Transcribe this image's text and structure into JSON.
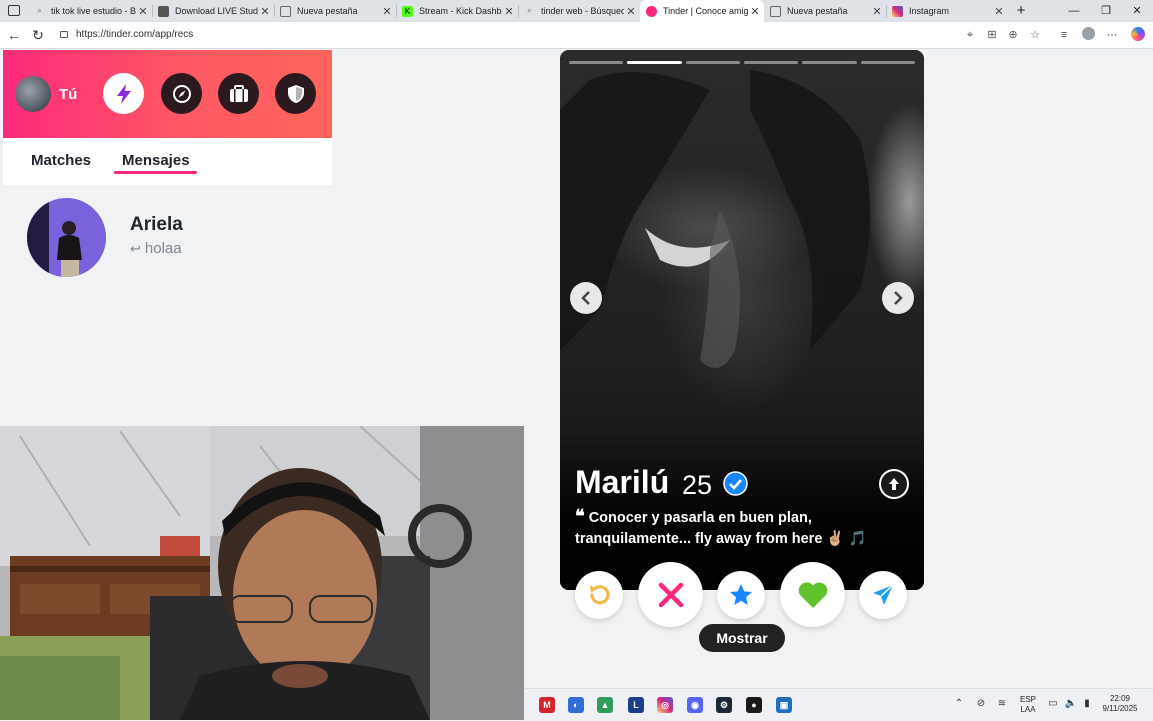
{
  "browser": {
    "tabs": [
      {
        "title": "tik tok live estudio - Bús",
        "active": false
      },
      {
        "title": "Download LIVE Studio",
        "active": false
      },
      {
        "title": "Nueva pestaña",
        "active": false
      },
      {
        "title": "Stream - Kick Dashboar",
        "active": false
      },
      {
        "title": "tinder web - Búsqueda",
        "active": false
      },
      {
        "title": "Tinder | Conoce amigos",
        "active": true
      },
      {
        "title": "Nueva pestaña",
        "active": false
      },
      {
        "title": "Instagram",
        "active": false
      }
    ],
    "url": "https://tinder.com/app/recs"
  },
  "sidebar": {
    "user_label": "Tú",
    "tabs": {
      "matches": "Matches",
      "messages": "Mensajes"
    },
    "conversation": {
      "name": "Ariela",
      "last_message": "holaa"
    }
  },
  "profile": {
    "name": "Marilú",
    "age": "25",
    "bio_line1": "Conocer y pasarla en buen plan,",
    "bio_line2": "tranquilamente... fly away from here ✌🏼 🎵",
    "photo_count": 6,
    "photo_index": 2
  },
  "actions": {
    "show_label": "Mostrar"
  },
  "taskbar": {
    "lang_top": "ESP",
    "lang_bottom": "LAA",
    "time": "22:09",
    "date": "9/11/2025"
  },
  "colors": {
    "brand_gradient_start": "#fd297b",
    "brand_gradient_end": "#ff655b",
    "nope": "#fd267a",
    "superlike": "#1786ff",
    "like": "#5dc22c",
    "rewind": "#f5b748",
    "boost": "#1ea0f0"
  }
}
